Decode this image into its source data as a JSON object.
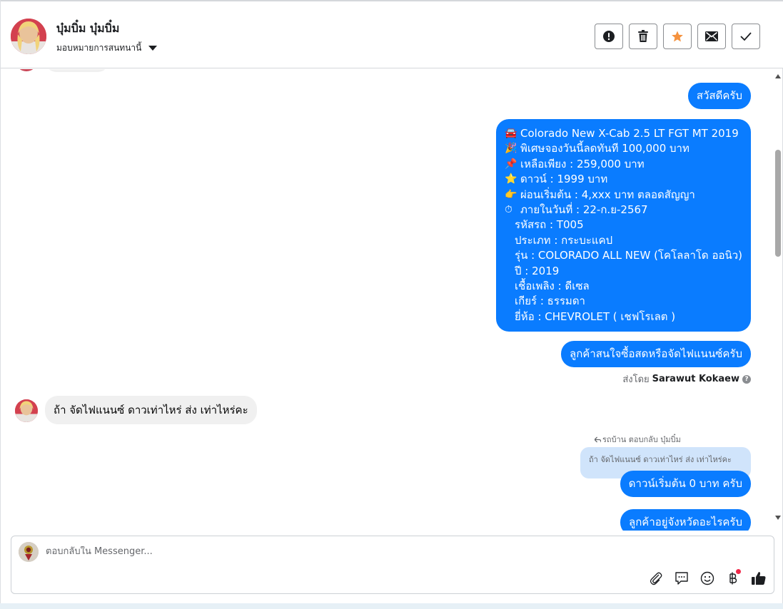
{
  "header": {
    "contact_name": "บุ๋มบิ๋ม บุ๋มบิ๋ม",
    "assign_label": "มอบหมายการสนทนานี้",
    "actions": [
      {
        "icon": "alert-icon"
      },
      {
        "icon": "trash-icon"
      },
      {
        "icon": "star-icon"
      },
      {
        "icon": "envelope-icon"
      },
      {
        "icon": "check-icon"
      }
    ]
  },
  "thread": {
    "msg_greeting": "สวัสดีครับ",
    "promo": {
      "line1": "Colorado New X-Cab 2.5 LT FGT MT 2019",
      "line2": "พิเศษจองวันนี้ลดทันที 100,000 บาท",
      "line3": "เหลือเพียง : 259,000 บาท",
      "line4": "ดาวน์ : 1999 บาท",
      "line5": "ผ่อนเริ่มต้น : 4,xxx บาท ตลอดสัญญา",
      "line6": "ภายในวันที่ : 22-ก.ย-2567",
      "line7": "รหัสรถ : T005",
      "line8": "ประเภท : กระบะแคป",
      "line9": "รุ่น : COLORADO ALL NEW (โคโลลาโด ออนิว)",
      "line10": "ปี : 2019",
      "line11": "เชื้อเพลิง : ดีเซล",
      "line12": "เกียร์ : ธรรมดา",
      "line13": "ยี่ห้อ : CHEVROLET ( เชฟโรเลต )"
    },
    "msg_question": "ลูกค้าสนใจซื้อสดหรือจัดไฟแนนซ์ครับ",
    "sent_by_prefix": "ส่งโดย",
    "sent_by_name": "Sarawut Kokaew",
    "incoming_msg": "ถ้า จัดไฟแนนซ์  ดาวเท่าไหร่ ส่ง เท่าไหร่คะ",
    "reply_label": "รถบ้าน ตอบกลับ บุ๋มบิ๋ม",
    "quoted_text": "ถ้า จัดไฟแนนซ์ ดาวเท่าไหร่ ส่ง เท่าไหร่คะ",
    "msg_down": "ดาวน์เริ่มต้น 0 บาท ครับ",
    "msg_province": "ลูกค้าอยู่จังหวัดอะไรครับ"
  },
  "composer": {
    "placeholder": "ตอบกลับใน Messenger...",
    "tools": [
      "paperclip-icon",
      "chat-bubble-icon",
      "emoji-icon",
      "baht-icon",
      "thumbs-up-icon"
    ]
  },
  "colors": {
    "outgoing_bubble": "#0a7cff",
    "incoming_bubble": "#f0f0f0",
    "quoted_bubble": "#d0e4fb",
    "star_accent": "#f5923e"
  }
}
